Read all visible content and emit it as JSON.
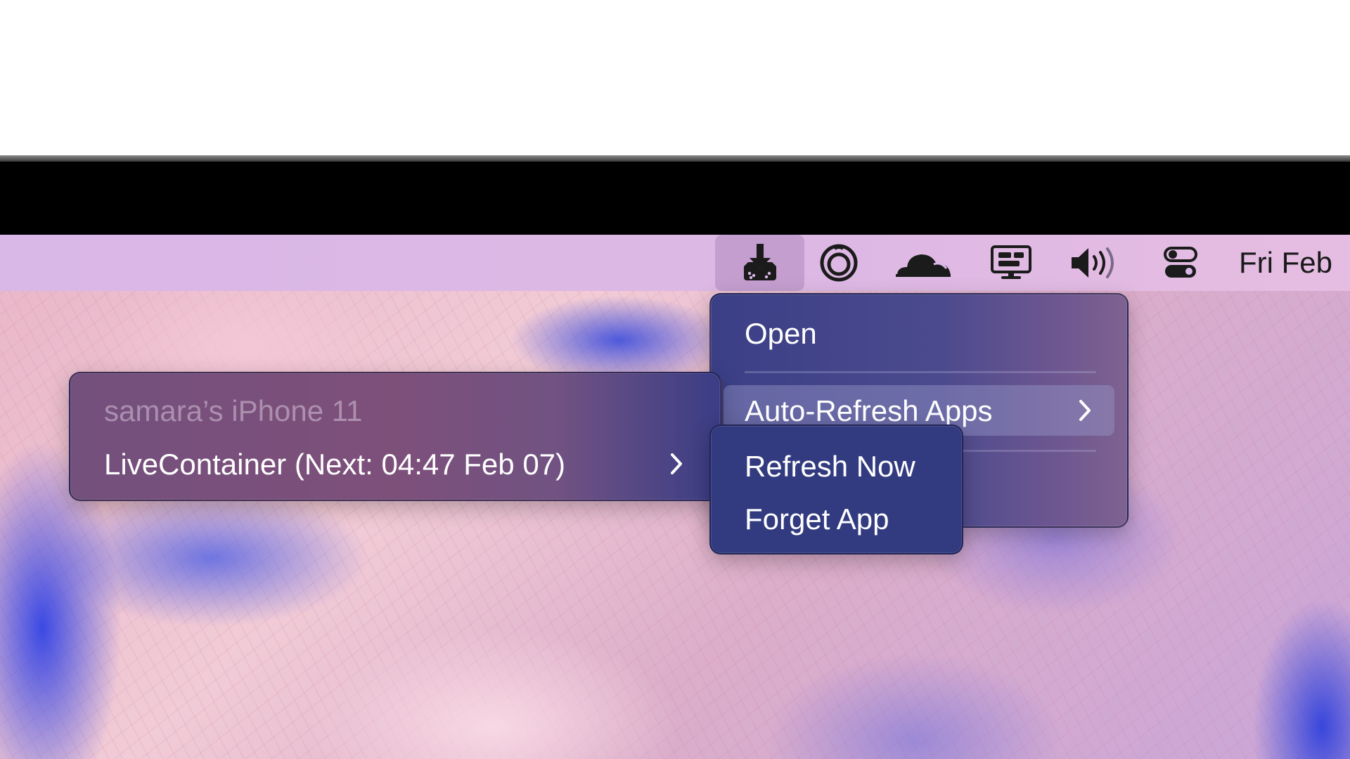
{
  "menubar": {
    "icons": [
      {
        "name": "download-tray-icon",
        "active": true
      },
      {
        "name": "circle-ring-icon",
        "active": false
      },
      {
        "name": "cloudflare-cloud-icon",
        "active": false
      },
      {
        "name": "display-monitor-icon",
        "active": false
      },
      {
        "name": "speaker-volume-icon",
        "active": false
      },
      {
        "name": "control-center-toggle-icon",
        "active": false
      }
    ],
    "clock": "Fri Feb"
  },
  "main_menu": {
    "open": "Open",
    "auto_refresh": "Auto-Refresh Apps"
  },
  "device_menu": {
    "device_name": "samara’s iPhone 11",
    "app_entry": "LiveContainer (Next: 04:47 Feb 07)"
  },
  "app_submenu": {
    "refresh_now": "Refresh Now",
    "forget_app": "Forget App"
  },
  "colors": {
    "menubar": "#dab7e5",
    "menu_main": "#3b3f86",
    "menu_sub": "#333b80",
    "text": "#ffffff"
  }
}
